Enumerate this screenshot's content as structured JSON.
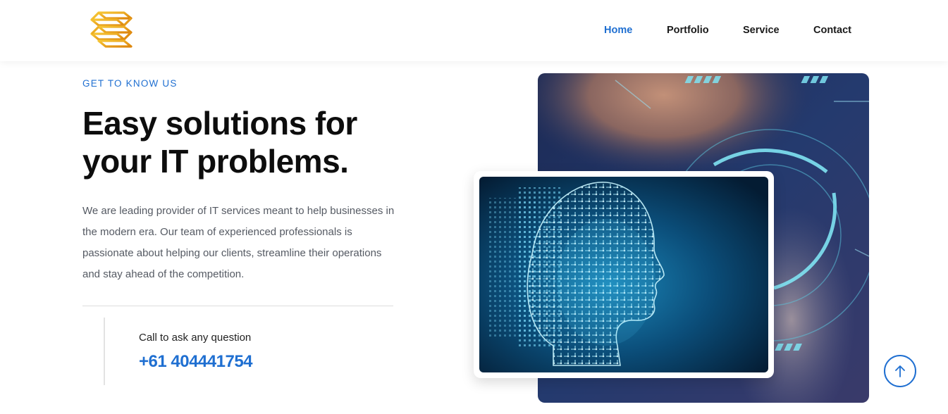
{
  "header": {
    "logo": {
      "name": "company-logo",
      "icon": "stacked-s-logo",
      "colors": [
        "#f2b21a",
        "#e08a0b"
      ]
    },
    "nav": [
      {
        "label": "Home",
        "active": true
      },
      {
        "label": "Portfolio",
        "active": false
      },
      {
        "label": "Service",
        "active": false
      },
      {
        "label": "Contact",
        "active": false
      }
    ]
  },
  "hero": {
    "eyebrow": "GET TO KNOW US",
    "headline_line1": "Easy solutions for",
    "headline_line2": "your IT problems.",
    "body": "We are leading provider of IT services meant to help businesses in the modern era. Our team of experienced professionals is passionate about helping our clients, streamline their operations and stay ahead of the competition.",
    "call_label": "Call to ask any question",
    "phone": "+61 404441754"
  },
  "images": {
    "back": "tech-person-hud-image",
    "front": "ai-circuit-head-image"
  },
  "scroll_top": {
    "icon": "arrow-up-icon"
  },
  "colors": {
    "accent": "#1f6fd1",
    "text": "#0d0d0d",
    "muted": "#555a63"
  }
}
